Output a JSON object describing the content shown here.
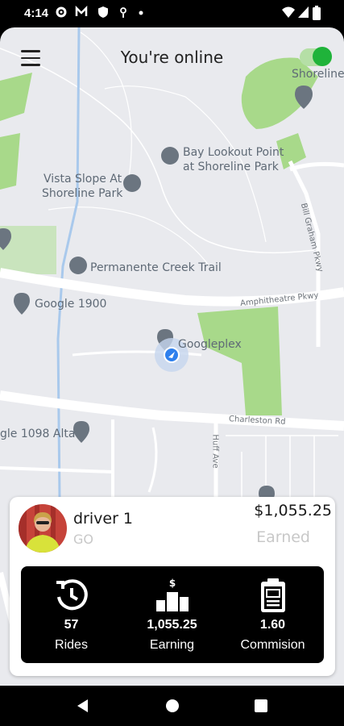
{
  "status_bar": {
    "time": "4:14"
  },
  "header": {
    "title": "You're online",
    "online_toggle_on": true
  },
  "map": {
    "labels": {
      "shoreline": "Shoreline",
      "bay_lookout_1": "Bay Lookout Point",
      "bay_lookout_2": "at Shoreline Park",
      "vista_1": "Vista Slope At",
      "vista_2": "Shoreline Park",
      "permanente": "Permanente Creek Trail",
      "google_1900": "Google 1900",
      "googleplex": "Googleplex",
      "google_1098": "gle 1098 Alta",
      "amphitheatre": "Amphitheatre Pkwy",
      "charleston": "Charleston Rd",
      "bill_graham": "Bill Graham Pkwy",
      "huff": "Huff Ave"
    }
  },
  "driver": {
    "name": "driver 1",
    "subtitle": "GO",
    "earned_amount": "$1,055.25",
    "earned_label": "Earned"
  },
  "stats": [
    {
      "icon": "history-icon",
      "value": "57",
      "label": "Rides"
    },
    {
      "icon": "earning-podium-icon",
      "value": "1,055.25",
      "label": "Earning"
    },
    {
      "icon": "commission-clipboard-icon",
      "value": "1.60",
      "label": "Commision"
    }
  ],
  "colors": {
    "online_green": "#1fb33a",
    "park_green": "#a8d98a",
    "map_background": "#e9eaee"
  }
}
